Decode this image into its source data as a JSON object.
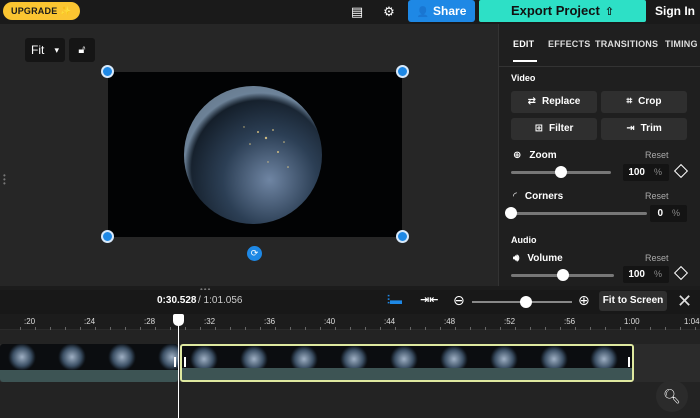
{
  "topbar": {
    "upgrade_label": "UPGRADE",
    "share_label": "Share",
    "export_label": "Export Project",
    "signin_label": "Sign In"
  },
  "preview": {
    "fit_label": "Fit"
  },
  "panel": {
    "tabs": [
      "EDIT",
      "EFFECTS",
      "TRANSITIONS",
      "TIMING"
    ],
    "active_tab": "EDIT",
    "video_section": "Video",
    "buttons": {
      "replace": "Replace",
      "crop": "Crop",
      "filter": "Filter",
      "trim": "Trim"
    },
    "zoom": {
      "label": "Zoom",
      "reset": "Reset",
      "value": "100",
      "unit": "%",
      "level": 0.5
    },
    "corners": {
      "label": "Corners",
      "reset": "Reset",
      "value": "0",
      "unit": "%",
      "level": 0
    },
    "audio_section": "Audio",
    "volume": {
      "label": "Volume",
      "reset": "Reset",
      "value": "100",
      "unit": "%",
      "level": 0.5
    }
  },
  "timeline": {
    "current_time": "0:30.528",
    "total_time": "/ 1:01.056",
    "fit_to_screen": "Fit to Screen",
    "ruler_labels": [
      ":20",
      ":24",
      ":28",
      ":32",
      ":36",
      ":40",
      ":44",
      ":48",
      ":52",
      ":56",
      "1:00",
      "1:04"
    ]
  },
  "colors": {
    "accent": "#1e88e5",
    "export": "#2de0c6",
    "upgrade": "#fbc531",
    "selected_clip_border": "#dfe9a0"
  }
}
